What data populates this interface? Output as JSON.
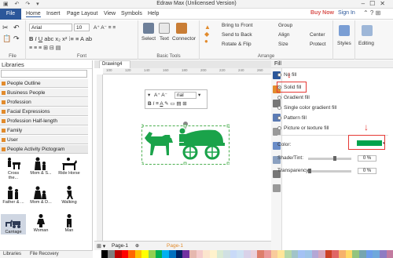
{
  "title": "Edraw Max (Unlicensed Version)",
  "menu": {
    "file": "File",
    "tabs": [
      "Home",
      "Insert",
      "Page Layout",
      "View",
      "Symbols",
      "Help"
    ],
    "buy_now": "Buy Now",
    "sign_in": "Sign In"
  },
  "ribbon": {
    "font_name": "Arial",
    "font_size": "10",
    "group_file": "File",
    "group_font": "Font",
    "group_basic_tools": "Basic Tools",
    "group_arrange": "Arrange",
    "select": "Select",
    "text": "Text",
    "connector": "Connector",
    "bring_front": "Bring to Front",
    "send_back": "Send to Back",
    "rotate_flip": "Rotate & Flip",
    "group": "Group",
    "align": "Align",
    "size": "Size",
    "center": "Center",
    "protect": "Protect",
    "styles": "Styles",
    "editing": "Editing"
  },
  "libraries": {
    "title": "Libraries",
    "items": [
      "People Outline",
      "Business People",
      "Profession",
      "Facial Expressions",
      "Profession Half-length",
      "Family",
      "User",
      "People Activity Pictogram"
    ],
    "shapes": [
      "Cross the...",
      "Mom & S...",
      "Ride Horse",
      "Father & ...",
      "Mom & D...",
      "Walking",
      "Carriage",
      "Woman",
      "Man"
    ],
    "footer": [
      "Libraries",
      "File Recovery"
    ]
  },
  "canvas": {
    "tab": "Drawing4",
    "ruler_ticks": [
      "100",
      "120",
      "140",
      "160",
      "180",
      "200",
      "220",
      "240",
      "260"
    ],
    "mini_font": "rial",
    "page_tabs": [
      "Page-1",
      "Page-1"
    ]
  },
  "fill_panel": {
    "title": "Fill",
    "options": [
      {
        "label": "No fill",
        "checked": false
      },
      {
        "label": "Solid fill",
        "checked": true
      },
      {
        "label": "Gradient fill",
        "checked": false
      },
      {
        "label": "Single color gradient fill",
        "checked": false
      },
      {
        "label": "Pattern fill",
        "checked": false
      },
      {
        "label": "Picture or texture fill",
        "checked": false
      }
    ],
    "color_label": "Color:",
    "color_value": "#00a34d",
    "shade_label": "Shade/Tint:",
    "shade_value": "0 %",
    "transparency_label": "Transparency:",
    "transparency_value": "0 %"
  },
  "colors": {
    "accent": "#2b579a",
    "shape_fill": "#1aa34a",
    "highlight": "#e53935"
  }
}
